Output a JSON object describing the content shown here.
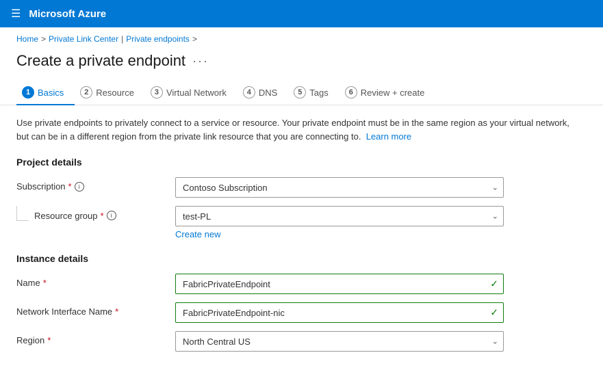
{
  "topnav": {
    "brand": "Microsoft Azure"
  },
  "breadcrumb": {
    "items": [
      "Home",
      "Private Link Center",
      "Private endpoints"
    ],
    "separators": [
      ">",
      ">",
      ">"
    ]
  },
  "page": {
    "title": "Create a private endpoint",
    "ellipsis": "···"
  },
  "tabs": [
    {
      "num": "1",
      "label": "Basics",
      "active": true
    },
    {
      "num": "2",
      "label": "Resource",
      "active": false
    },
    {
      "num": "3",
      "label": "Virtual Network",
      "active": false
    },
    {
      "num": "4",
      "label": "DNS",
      "active": false
    },
    {
      "num": "5",
      "label": "Tags",
      "active": false
    },
    {
      "num": "6",
      "label": "Review + create",
      "active": false
    }
  ],
  "info_text": "Use private endpoints to privately connect to a service or resource. Your private endpoint must be in the same region as your virtual network, but can be in a different region from the private link resource that you are connecting to.",
  "info_link": "Learn more",
  "sections": {
    "project": {
      "heading": "Project details",
      "fields": [
        {
          "label": "Subscription",
          "required": true,
          "info": true,
          "value": "Contoso Subscription",
          "has_arrow": true,
          "valid": false
        },
        {
          "label": "Resource group",
          "required": true,
          "info": true,
          "value": "test-PL",
          "has_arrow": true,
          "valid": false,
          "indented": true,
          "create_new": "Create new"
        }
      ]
    },
    "instance": {
      "heading": "Instance details",
      "fields": [
        {
          "label": "Name",
          "required": true,
          "info": false,
          "value": "FabricPrivateEndpoint",
          "valid": true
        },
        {
          "label": "Network Interface Name",
          "required": true,
          "info": false,
          "value": "FabricPrivateEndpoint-nic",
          "valid": true
        },
        {
          "label": "Region",
          "required": true,
          "info": false,
          "value": "North Central US",
          "has_arrow": true,
          "valid": false
        }
      ]
    }
  }
}
